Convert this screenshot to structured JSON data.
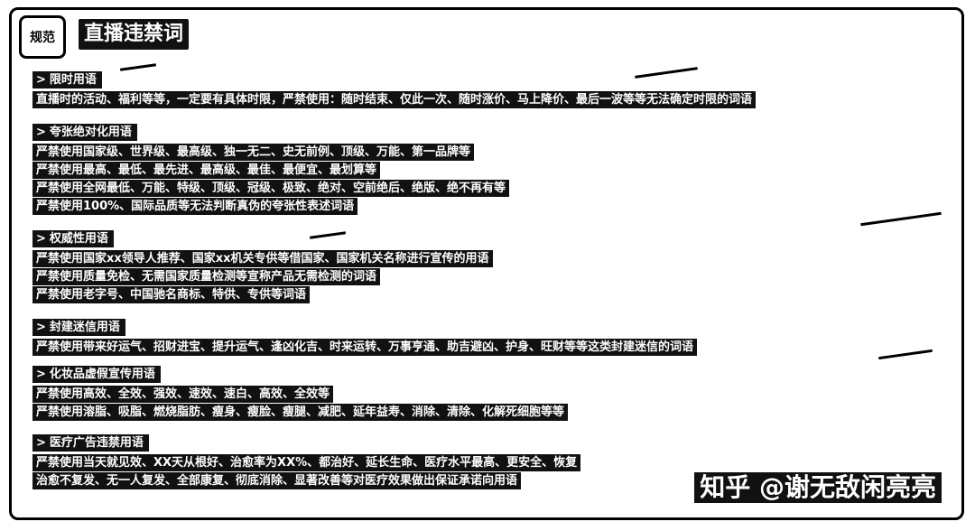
{
  "badge": "规范",
  "title": "直播违禁词",
  "sections": [
    {
      "heading": "限时用语",
      "lines": [
        "直播时的活动、福利等等，一定要有具体时限，严禁使用：随时结束、仅此一次、随时涨价、马上降价、最后一波等等无法确定时限的词语"
      ]
    },
    {
      "heading": "夸张绝对化用语",
      "lines": [
        "严禁使用国家级、世界级、最高级、独一无二、史无前例、顶级、万能、第一品牌等",
        "严禁使用最高、最低、最先进、最高级、最佳、最便宜、最划算等",
        "严禁使用全网最低、万能、特级、顶级、冠级、极致、绝对、空前绝后、绝版、绝不再有等",
        "严禁使用100%、国际品质等无法判断真伪的夸张性表述词语"
      ]
    },
    {
      "heading": "权威性用语",
      "lines": [
        "严禁使用国家xx领导人推荐、国家xx机关专供等借国家、国家机关名称进行宣传的用语",
        "严禁使用质量免检、无需国家质量检测等宣称产品无需检测的词语",
        "严禁使用老字号、中国驰名商标、特供、专供等词语"
      ]
    },
    {
      "heading": "封建迷信用语",
      "lines": [
        "严禁使用带来好运气、招财进宝、提升运气、逢凶化吉、时来运转、万事亨通、助吉避凶、护身、旺财等等这类封建迷信的词语"
      ]
    },
    {
      "heading": "化妆品虚假宣传用语",
      "lines": [
        "严禁使用高效、全效、强效、速效、速白、高效、全效等",
        "严禁使用溶脂、吸脂、燃烧脂肪、瘦身、瘦脸、瘦腿、减肥、延年益寿、消除、清除、化解死细胞等等"
      ]
    },
    {
      "heading": "医疗广告违禁用语",
      "lines": [
        "严禁使用当天就见效、XX天从根好、治愈率为XX%、都治好、延长生命、医疗水平最高、更安全、恢复",
        "治愈不复发、无一人复发、全部康复、彻底消除、显著改善等对医疗效果做出保证承诺向用语"
      ]
    }
  ],
  "watermark": "知乎 @谢无敌闲亮亮"
}
